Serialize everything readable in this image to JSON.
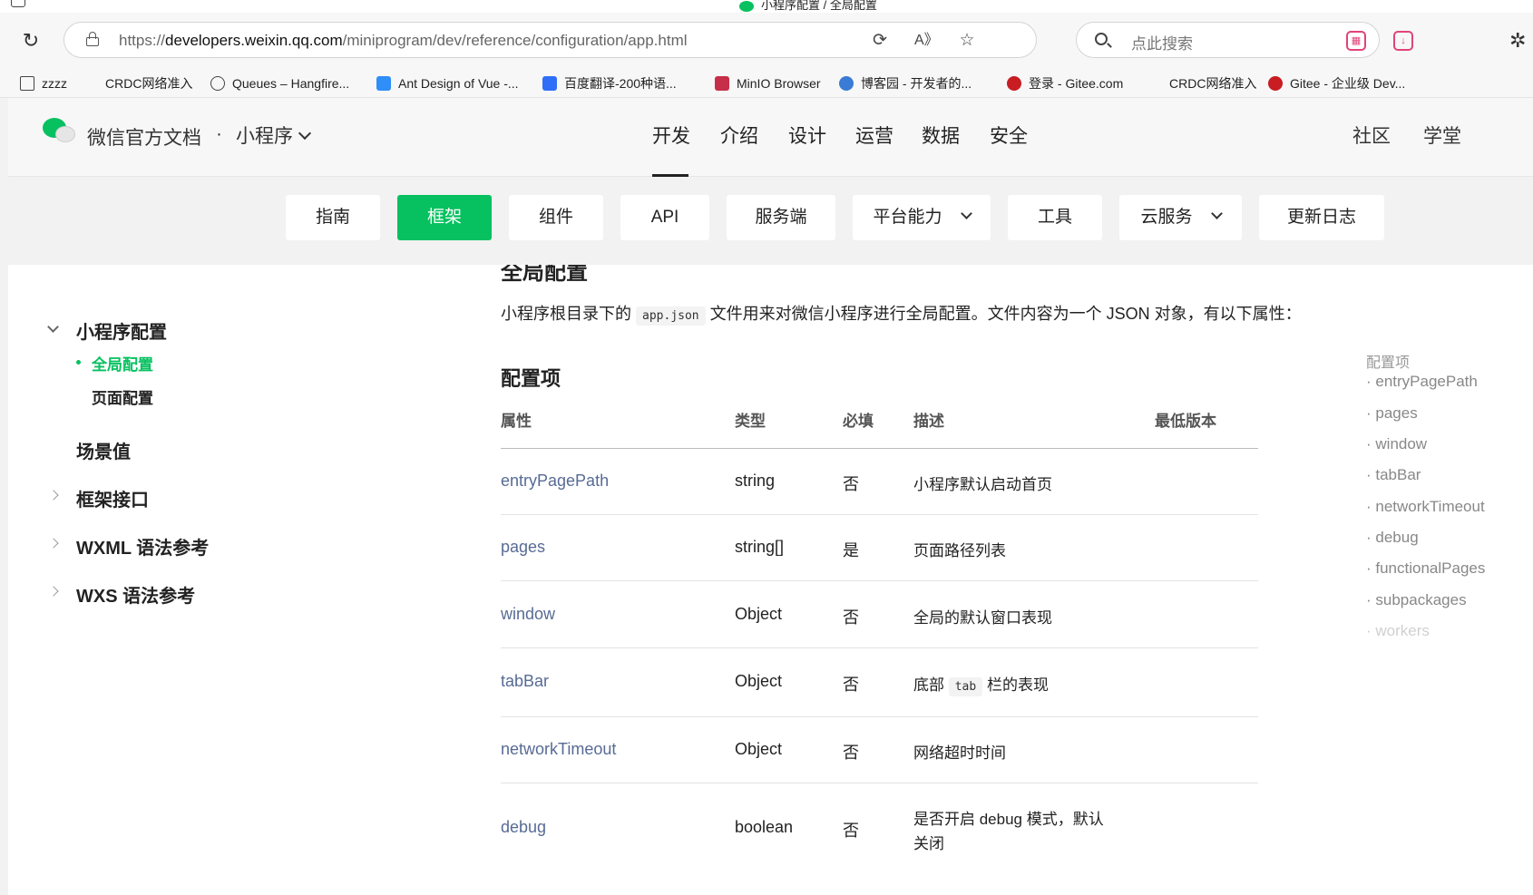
{
  "window": {
    "title": "小程序配置 / 全局配置"
  },
  "browser": {
    "url_prefix": "https://",
    "url_host": "developers.weixin.qq.com",
    "url_path": "/miniprogram/dev/reference/configuration/app.html",
    "search_placeholder": "点此搜索",
    "bookmarks": [
      {
        "label": "zzzz",
        "icon": "folder-icon",
        "color": "#444444"
      },
      {
        "label": "CRDC网络准入",
        "icon": "page-icon",
        "color": "#f7f7f7"
      },
      {
        "label": "Queues – Hangfire...",
        "icon": "globe-icon",
        "color": "#444444"
      },
      {
        "label": "Ant Design of Vue -...",
        "icon": "antd-icon",
        "color": "#2f8ef7"
      },
      {
        "label": "百度翻译-200种语...",
        "icon": "baidu-translate-icon",
        "color": "#2f6ff7"
      },
      {
        "label": "MinIO Browser",
        "icon": "minio-icon",
        "color": "#c72e49"
      },
      {
        "label": "博客园 - 开发者的...",
        "icon": "cnblogs-icon",
        "color": "#3a7bd5"
      },
      {
        "label": "登录 - Gitee.com",
        "icon": "gitee-icon",
        "color": "#c71d23"
      },
      {
        "label": "CRDC网络准入",
        "icon": "page-icon",
        "color": "#f7f7f7"
      },
      {
        "label": "Gitee - 企业级 Dev...",
        "icon": "gitee-icon",
        "color": "#c71d23"
      }
    ]
  },
  "site": {
    "brand": "微信官方文档",
    "dot": "·",
    "product": "小程序",
    "topnav": [
      "开发",
      "介绍",
      "设计",
      "运营",
      "数据",
      "安全"
    ],
    "rightnav": [
      "社区",
      "学堂"
    ],
    "subnav": [
      "指南",
      "框架",
      "组件",
      "API",
      "服务端",
      "平台能力",
      "工具",
      "云服务",
      "更新日志"
    ]
  },
  "sidebar": {
    "group": "小程序配置",
    "subitems": [
      "全局配置",
      "页面配置"
    ],
    "items": [
      "场景值",
      "框架接口",
      "WXML 语法参考",
      "WXS 语法参考"
    ]
  },
  "content": {
    "heading": "全局配置",
    "intro_before": "小程序根目录下的",
    "intro_code": "app.json",
    "intro_after": "文件用来对微信小程序进行全局配置。文件内容为一个 JSON 对象，有以下属性：",
    "section": "配置项",
    "columns": [
      "属性",
      "类型",
      "必填",
      "描述",
      "最低版本"
    ],
    "rows": [
      {
        "name": "entryPagePath",
        "type": "string",
        "required": "否",
        "desc": "小程序默认启动首页"
      },
      {
        "name": "pages",
        "type": "string[]",
        "required": "是",
        "desc": "页面路径列表"
      },
      {
        "name": "window",
        "type": "Object",
        "required": "否",
        "desc": "全局的默认窗口表现"
      },
      {
        "name": "tabBar",
        "type": "Object",
        "required": "否",
        "desc_before": "底部",
        "desc_code": "tab",
        "desc_after": "栏的表现"
      },
      {
        "name": "networkTimeout",
        "type": "Object",
        "required": "否",
        "desc": "网络超时时间"
      },
      {
        "name": "debug",
        "type": "boolean",
        "required": "否",
        "desc_line1": "是否开启 debug 模式，默认",
        "desc_line2": "关闭"
      }
    ]
  },
  "toc": {
    "title": "配置项",
    "items": [
      "· entryPagePath",
      "· pages",
      "· window",
      "· tabBar",
      "· networkTimeout",
      "· debug",
      "· functionalPages",
      "· subpackages",
      "· workers"
    ]
  },
  "colors": {
    "accent": "#07c160",
    "link": "#576b95"
  }
}
